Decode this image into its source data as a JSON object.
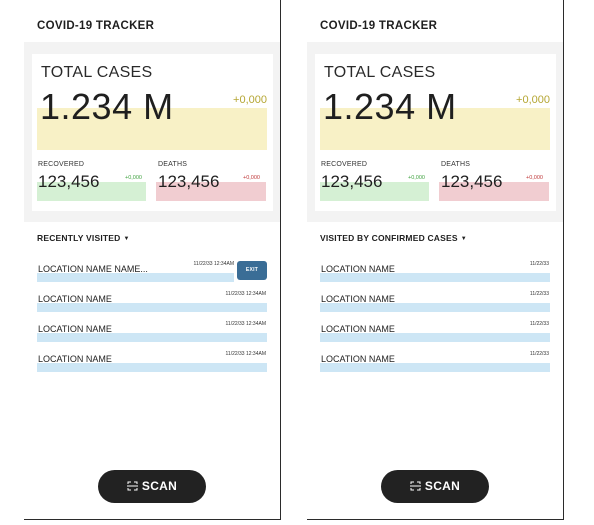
{
  "screens": [
    {
      "app_title": "COVID-19 TRACKER",
      "total_label": "TOTAL CASES",
      "total_value": "1.234 M",
      "total_delta": "+0,000",
      "recovered_label": "RECOVERED",
      "recovered_value": "123,456",
      "recovered_delta": "+0,000",
      "deaths_label": "DEATHS",
      "deaths_value": "123,456",
      "deaths_delta": "+0,000",
      "section_title": "RECENTLY VISITED",
      "visits": [
        {
          "name": "LOCATION NAME NAME...",
          "time": "11/22/33 12:34AM"
        },
        {
          "name": "LOCATION NAME",
          "time": "11/22/33 12:34AM"
        },
        {
          "name": "LOCATION NAME",
          "time": "11/22/33 12:34AM"
        },
        {
          "name": "LOCATION NAME",
          "time": "11/22/33 12:34AM"
        }
      ],
      "exit_label": "EXIT",
      "scan_label": "SCAN"
    },
    {
      "app_title": "COVID-19 TRACKER",
      "total_label": "TOTAL CASES",
      "total_value": "1.234 M",
      "total_delta": "+0,000",
      "recovered_label": "RECOVERED",
      "recovered_value": "123,456",
      "recovered_delta": "+0,000",
      "deaths_label": "DEATHS",
      "deaths_value": "123,456",
      "deaths_delta": "+0,000",
      "section_title": "VISITED BY CONFIRMED CASES",
      "visits": [
        {
          "name": "LOCATION NAME",
          "time": "11/22/33"
        },
        {
          "name": "LOCATION NAME",
          "time": "11/22/33"
        },
        {
          "name": "LOCATION NAME",
          "time": "11/22/33"
        },
        {
          "name": "LOCATION NAME",
          "time": "11/22/33"
        }
      ],
      "scan_label": "SCAN"
    }
  ],
  "icons": {
    "section_caret": "caret-down-icon",
    "scan": "scan-frame-icon"
  },
  "colors": {
    "total_highlight": "#f8f1c6",
    "recovered_highlight": "#d5f0d4",
    "deaths_highlight": "#f1cdd1",
    "visit_highlight": "#cde6f5",
    "exit_button": "#3a6d96",
    "scan_button": "#222222"
  }
}
